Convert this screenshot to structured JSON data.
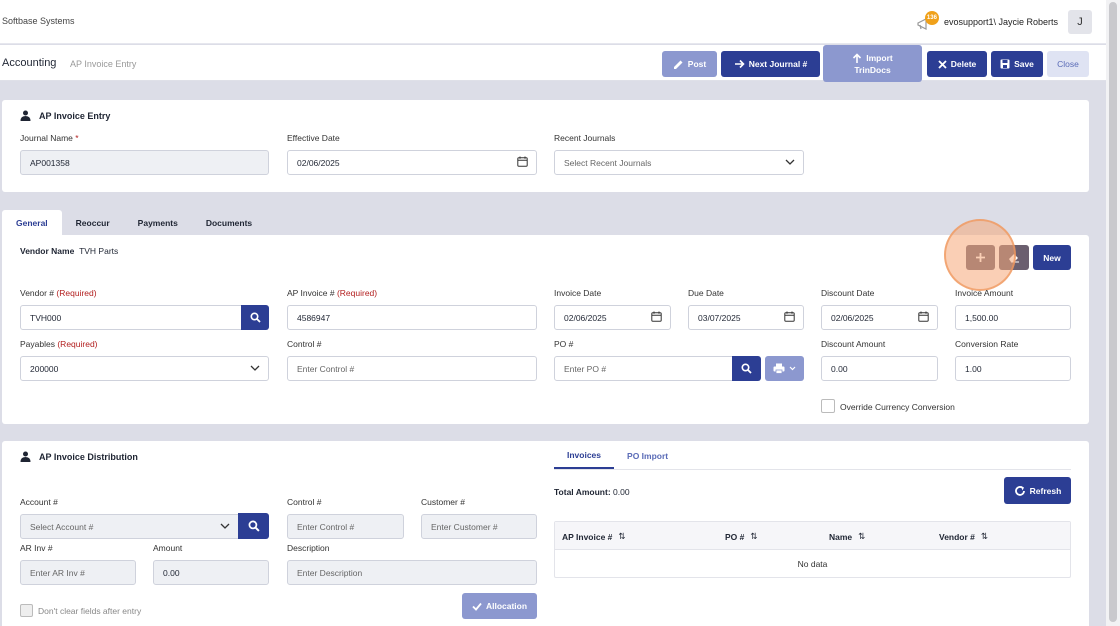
{
  "header": {
    "brand": "Softbase Systems",
    "notification_count": "136",
    "username": "evosupport1\\ Jaycie Roberts",
    "avatar_initial": "J"
  },
  "breadcrumb": {
    "main": "Accounting",
    "sub": "AP Invoice Entry"
  },
  "toolbar": {
    "post": "Post",
    "next_journal": "Next Journal #",
    "import_line1": "Import",
    "import_line2": "TrinDocs",
    "delete": "Delete",
    "save": "Save",
    "close": "Close"
  },
  "entry": {
    "title": "AP Invoice Entry",
    "journal_name_label": "Journal Name",
    "journal_name_req": "*",
    "journal_name_value": "AP001358",
    "effective_date_label": "Effective Date",
    "effective_date_value": "02/06/2025",
    "recent_journals_label": "Recent Journals",
    "recent_journals_placeholder": "Select Recent Journals"
  },
  "tabs": [
    "General",
    "Reoccur",
    "Payments",
    "Documents"
  ],
  "general": {
    "vendor_name_label": "Vendor Name",
    "vendor_name_value": "TVH Parts",
    "new_button": "New",
    "vendor_no_label": "Vendor #",
    "vendor_no_req": "(Required)",
    "vendor_no_value": "TVH000",
    "ap_invoice_label": "AP Invoice #",
    "ap_invoice_req": "(Required)",
    "ap_invoice_value": "4586947",
    "invoice_date_label": "Invoice Date",
    "invoice_date_value": "02/06/2025",
    "due_date_label": "Due Date",
    "due_date_value": "03/07/2025",
    "discount_date_label": "Discount Date",
    "discount_date_value": "02/06/2025",
    "invoice_amount_label": "Invoice Amount",
    "invoice_amount_value": "1,500.00",
    "payables_label": "Payables",
    "payables_req": "(Required)",
    "payables_value": "200000",
    "control_label": "Control #",
    "control_placeholder": "Enter Control #",
    "po_label": "PO #",
    "po_placeholder": "Enter PO #",
    "discount_amount_label": "Discount Amount",
    "discount_amount_value": "0.00",
    "conversion_rate_label": "Conversion Rate",
    "conversion_rate_value": "1.00",
    "override_label": "Override Currency Conversion"
  },
  "distribution": {
    "title": "AP Invoice Distribution",
    "account_label": "Account #",
    "account_placeholder": "Select Account #",
    "control_label": "Control #",
    "control_placeholder": "Enter Control #",
    "customer_label": "Customer #",
    "customer_placeholder": "Enter Customer #",
    "ar_inv_label": "AR Inv #",
    "ar_inv_placeholder": "Enter AR Inv #",
    "amount_label": "Amount",
    "amount_value": "0.00",
    "description_label": "Description",
    "description_placeholder": "Enter Description",
    "dont_clear_label": "Don't clear fields after entry",
    "allocation_button": "Allocation",
    "subtabs": [
      "Invoices",
      "PO Import"
    ],
    "total_amount_label": "Total Amount:",
    "total_amount_value": "0.00",
    "refresh_button": "Refresh",
    "table_headers": [
      "AP Invoice #",
      "PO #",
      "Name",
      "Vendor #"
    ],
    "no_data": "No data"
  },
  "colors": {
    "navy": "#2c3e94",
    "light_blue": "#8c98cf",
    "required_red": "#b32020",
    "badge_orange": "#f0a11a",
    "dark_button": "#6b5f6f"
  }
}
